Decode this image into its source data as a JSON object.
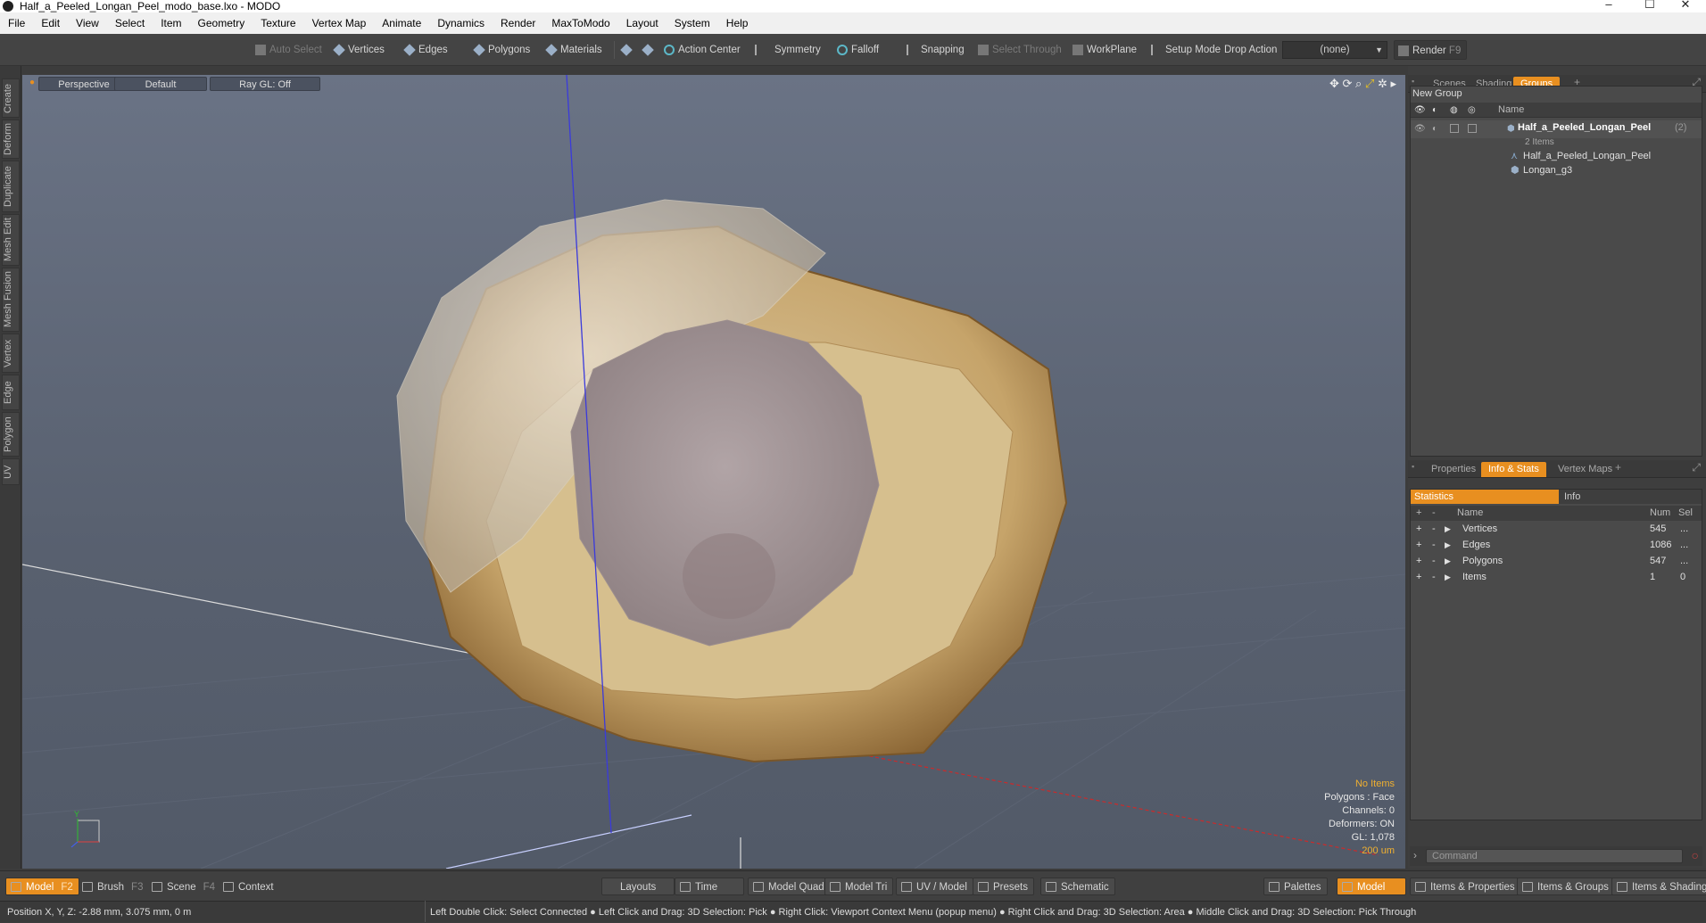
{
  "window": {
    "title": "Half_a_Peeled_Longan_Peel_modo_base.lxo - MODO",
    "min": "–",
    "max": "☐",
    "close": "✕"
  },
  "menu": [
    "File",
    "Edit",
    "View",
    "Select",
    "Item",
    "Geometry",
    "Texture",
    "Vertex Map",
    "Animate",
    "Dynamics",
    "Render",
    "MaxToModo",
    "Layout",
    "System",
    "Help"
  ],
  "toolbar": {
    "auto_select": "Auto Select",
    "vertices": "Vertices",
    "edges": "Edges",
    "polygons": "Polygons",
    "materials": "Materials",
    "action_center": "Action Center",
    "symmetry": "Symmetry",
    "falloff": "Falloff",
    "snapping": "Snapping",
    "select_through": "Select Through",
    "workplane": "WorkPlane",
    "setup_mode": "Setup Mode",
    "drop_action": "Drop Action",
    "drop_value": "(none)",
    "render": "Render",
    "render_key": "F9"
  },
  "left_tabs": [
    "Create",
    "Deform",
    "Duplicate",
    "Mesh Edit",
    "Mesh Fusion",
    "Vertex",
    "Edge",
    "Polygon",
    "UV"
  ],
  "viewport": {
    "view": "Perspective",
    "shading": "Default",
    "raygl": "Ray GL: Off",
    "hud": {
      "items": "No Items",
      "polygons": "Polygons : Face",
      "channels": "Channels: 0",
      "deformers": "Deformers: ON",
      "gl": "GL: 1,078",
      "scale": "200 um"
    },
    "axis_y": "Y"
  },
  "groups_panel": {
    "tabs": [
      "Scenes",
      "Shading",
      "Groups"
    ],
    "active_tab": "Groups",
    "new_group": "New Group",
    "col_name": "Name",
    "group": {
      "name": "Half_a_Peeled_Longan_Peel",
      "count": "(2)",
      "sub": "2 Items"
    },
    "children": [
      "Half_a_Peeled_Longan_Peel",
      "Longan_g3"
    ]
  },
  "stats_panel": {
    "tabs": [
      "Properties",
      "Info & Stats",
      "Vertex Maps"
    ],
    "active_tab": "Info & Stats",
    "subtabs": [
      "Statistics",
      "Info"
    ],
    "cols": [
      "Name",
      "Num",
      "Sel"
    ],
    "rows": [
      {
        "name": "Vertices",
        "num": "545",
        "sel": "..."
      },
      {
        "name": "Edges",
        "num": "1086",
        "sel": "..."
      },
      {
        "name": "Polygons",
        "num": "547",
        "sel": "..."
      },
      {
        "name": "Items",
        "num": "1",
        "sel": "0"
      }
    ]
  },
  "command": {
    "placeholder": "Command"
  },
  "bottom": {
    "model": "Model",
    "model_key": "F2",
    "brush": "Brush",
    "brush_key": "F3",
    "scene": "Scene",
    "scene_key": "F4",
    "context": "Context",
    "layouts": "Layouts",
    "time": "Time",
    "model_quad": "Model Quad",
    "model_tri": "Model Tri",
    "uv_model": "UV / Model",
    "presets": "Presets",
    "schematic": "Schematic",
    "palettes": "Palettes",
    "model2": "Model",
    "items_props": "Items & Properties",
    "items_groups": "Items & Groups",
    "items_shading": "Items & Shading"
  },
  "status": {
    "position": "Position X, Y, Z:   -2.88 mm, 3.075 mm, 0 m",
    "hints": "Left Double Click: Select Connected ● Left Click and Drag: 3D Selection: Pick ● Right Click: Viewport Context Menu (popup menu) ● Right Click and Drag: 3D Selection: Area ● Middle Click and Drag: 3D Selection: Pick Through"
  }
}
